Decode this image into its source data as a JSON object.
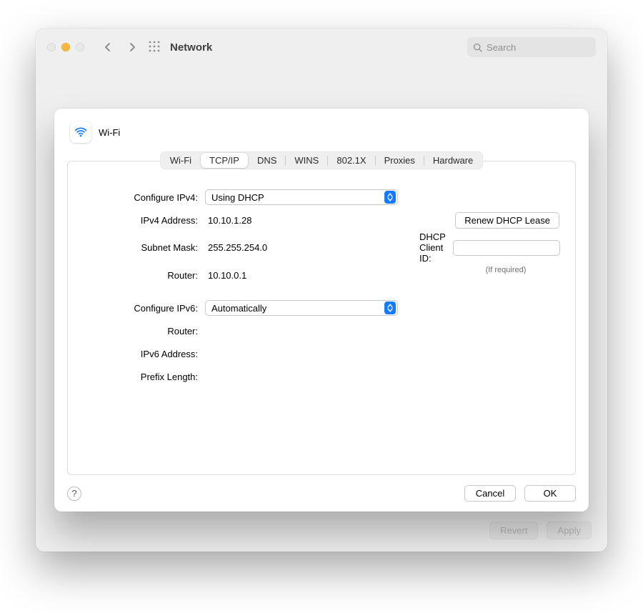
{
  "titlebar": {
    "title": "Network",
    "search_placeholder": "Search"
  },
  "bottom": {
    "revert": "Revert",
    "apply": "Apply"
  },
  "sheet": {
    "interface": "Wi-Fi",
    "tabs": {
      "wifi": "Wi-Fi",
      "tcpip": "TCP/IP",
      "dns": "DNS",
      "wins": "WINS",
      "8021x": "802.1X",
      "proxies": "Proxies",
      "hardware": "Hardware"
    },
    "labels": {
      "config_v4": "Configure IPv4:",
      "v4_addr": "IPv4 Address:",
      "subnet": "Subnet Mask:",
      "router4": "Router:",
      "config_v6": "Configure IPv6:",
      "router6": "Router:",
      "v6_addr": "IPv6 Address:",
      "prefix": "Prefix Length:",
      "dhcp_client": "DHCP Client ID:",
      "if_required": "(If required)"
    },
    "values": {
      "config_v4": "Using DHCP",
      "v4_addr": "10.10.1.28",
      "subnet": "255.255.254.0",
      "router4": "10.10.0.1",
      "config_v6": "Automatically",
      "router6": "",
      "v6_addr": "",
      "prefix": "",
      "dhcp_client": ""
    },
    "buttons": {
      "renew": "Renew DHCP Lease",
      "cancel": "Cancel",
      "ok": "OK",
      "help": "?"
    }
  }
}
